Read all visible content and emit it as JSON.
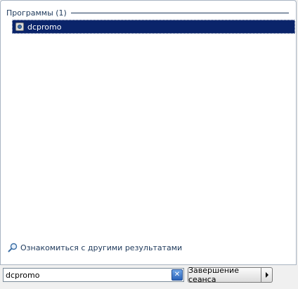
{
  "results": {
    "group_title": "Программы (1)",
    "items": [
      {
        "label": "dcpromo",
        "icon": "app-icon"
      }
    ]
  },
  "more_results": {
    "label": "Ознакомиться с другими результатами",
    "icon": "magnifier-icon"
  },
  "search": {
    "value": "dcpromo",
    "clear_icon": "clear-icon"
  },
  "shutdown": {
    "label": "Завершение сеанса",
    "arrow_icon": "chevron-right-icon"
  },
  "colors": {
    "selection": "#0a246a",
    "group_text": "#1e395b",
    "panel_border": "#a9b4c2"
  }
}
